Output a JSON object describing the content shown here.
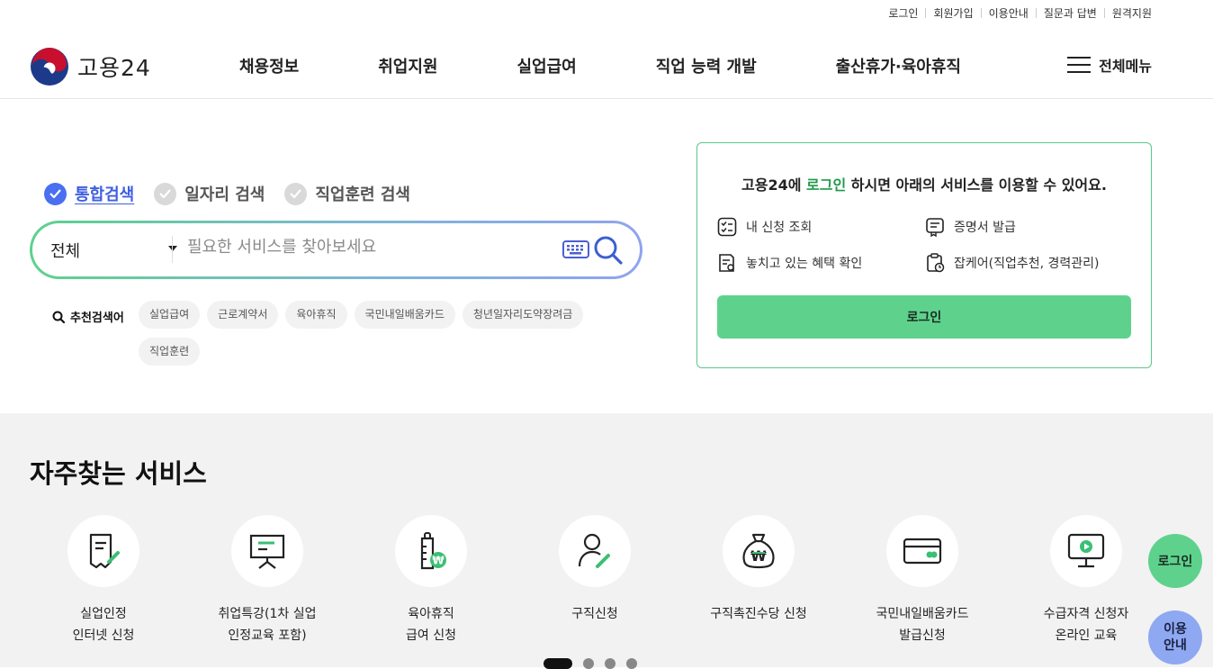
{
  "util_links": [
    "로그인",
    "회원가입",
    "이용안내",
    "질문과 답변",
    "원격지원"
  ],
  "logo": {
    "text": "고용24"
  },
  "gnb": [
    "채용정보",
    "취업지원",
    "실업급여",
    "직업 능력 개발",
    "출산휴가·육아휴직"
  ],
  "all_menu": "전체메뉴",
  "search": {
    "tabs": [
      {
        "label": "통합검색",
        "active": true
      },
      {
        "label": "일자리 검색",
        "active": false
      },
      {
        "label": "직업훈련 검색",
        "active": false
      }
    ],
    "category": "전체",
    "placeholder": "필요한 서비스를 찾아보세요",
    "recommend_title": "추천검색어",
    "recommend": [
      "실업급여",
      "근로계약서",
      "육아휴직",
      "국민내일배움카드",
      "청년일자리도약장려금",
      "직업훈련"
    ]
  },
  "login_box": {
    "msg_prefix": "고용24에 ",
    "msg_highlight": "로그인",
    "msg_suffix": " 하시면 아래의 서비스를 이용할 수 있어요.",
    "services": [
      "내 신청 조회",
      "증명서 발급",
      "놓치고 있는 혜택 확인",
      "잡케어(직업추천, 경력관리)"
    ],
    "button": "로그인"
  },
  "frequent": {
    "title": "자주찾는 서비스",
    "items": [
      {
        "label": "실업인정\n인터넷 신청",
        "icon": "document-pen-icon"
      },
      {
        "label": "취업특강(1차 실업\n인정교육 포함)",
        "icon": "presentation-board-icon"
      },
      {
        "label": "육아휴직\n급여 신청",
        "icon": "baby-bottle-won-icon"
      },
      {
        "label": "구직신청",
        "icon": "person-pen-icon"
      },
      {
        "label": "구직촉진수당 신청",
        "icon": "money-bag-won-icon"
      },
      {
        "label": "국민내일배움카드\n발급신청",
        "icon": "card-icon"
      },
      {
        "label": "수급자격 신청자\n온라인 교육",
        "icon": "monitor-play-icon"
      }
    ],
    "pager": {
      "pages": 4,
      "current": 1
    }
  },
  "floating": {
    "login": "로그인",
    "guide": "이용\n안내"
  },
  "colors": {
    "green": "#5ed28d",
    "blue": "#4a6ff0",
    "lavender": "#8fa8f2"
  }
}
